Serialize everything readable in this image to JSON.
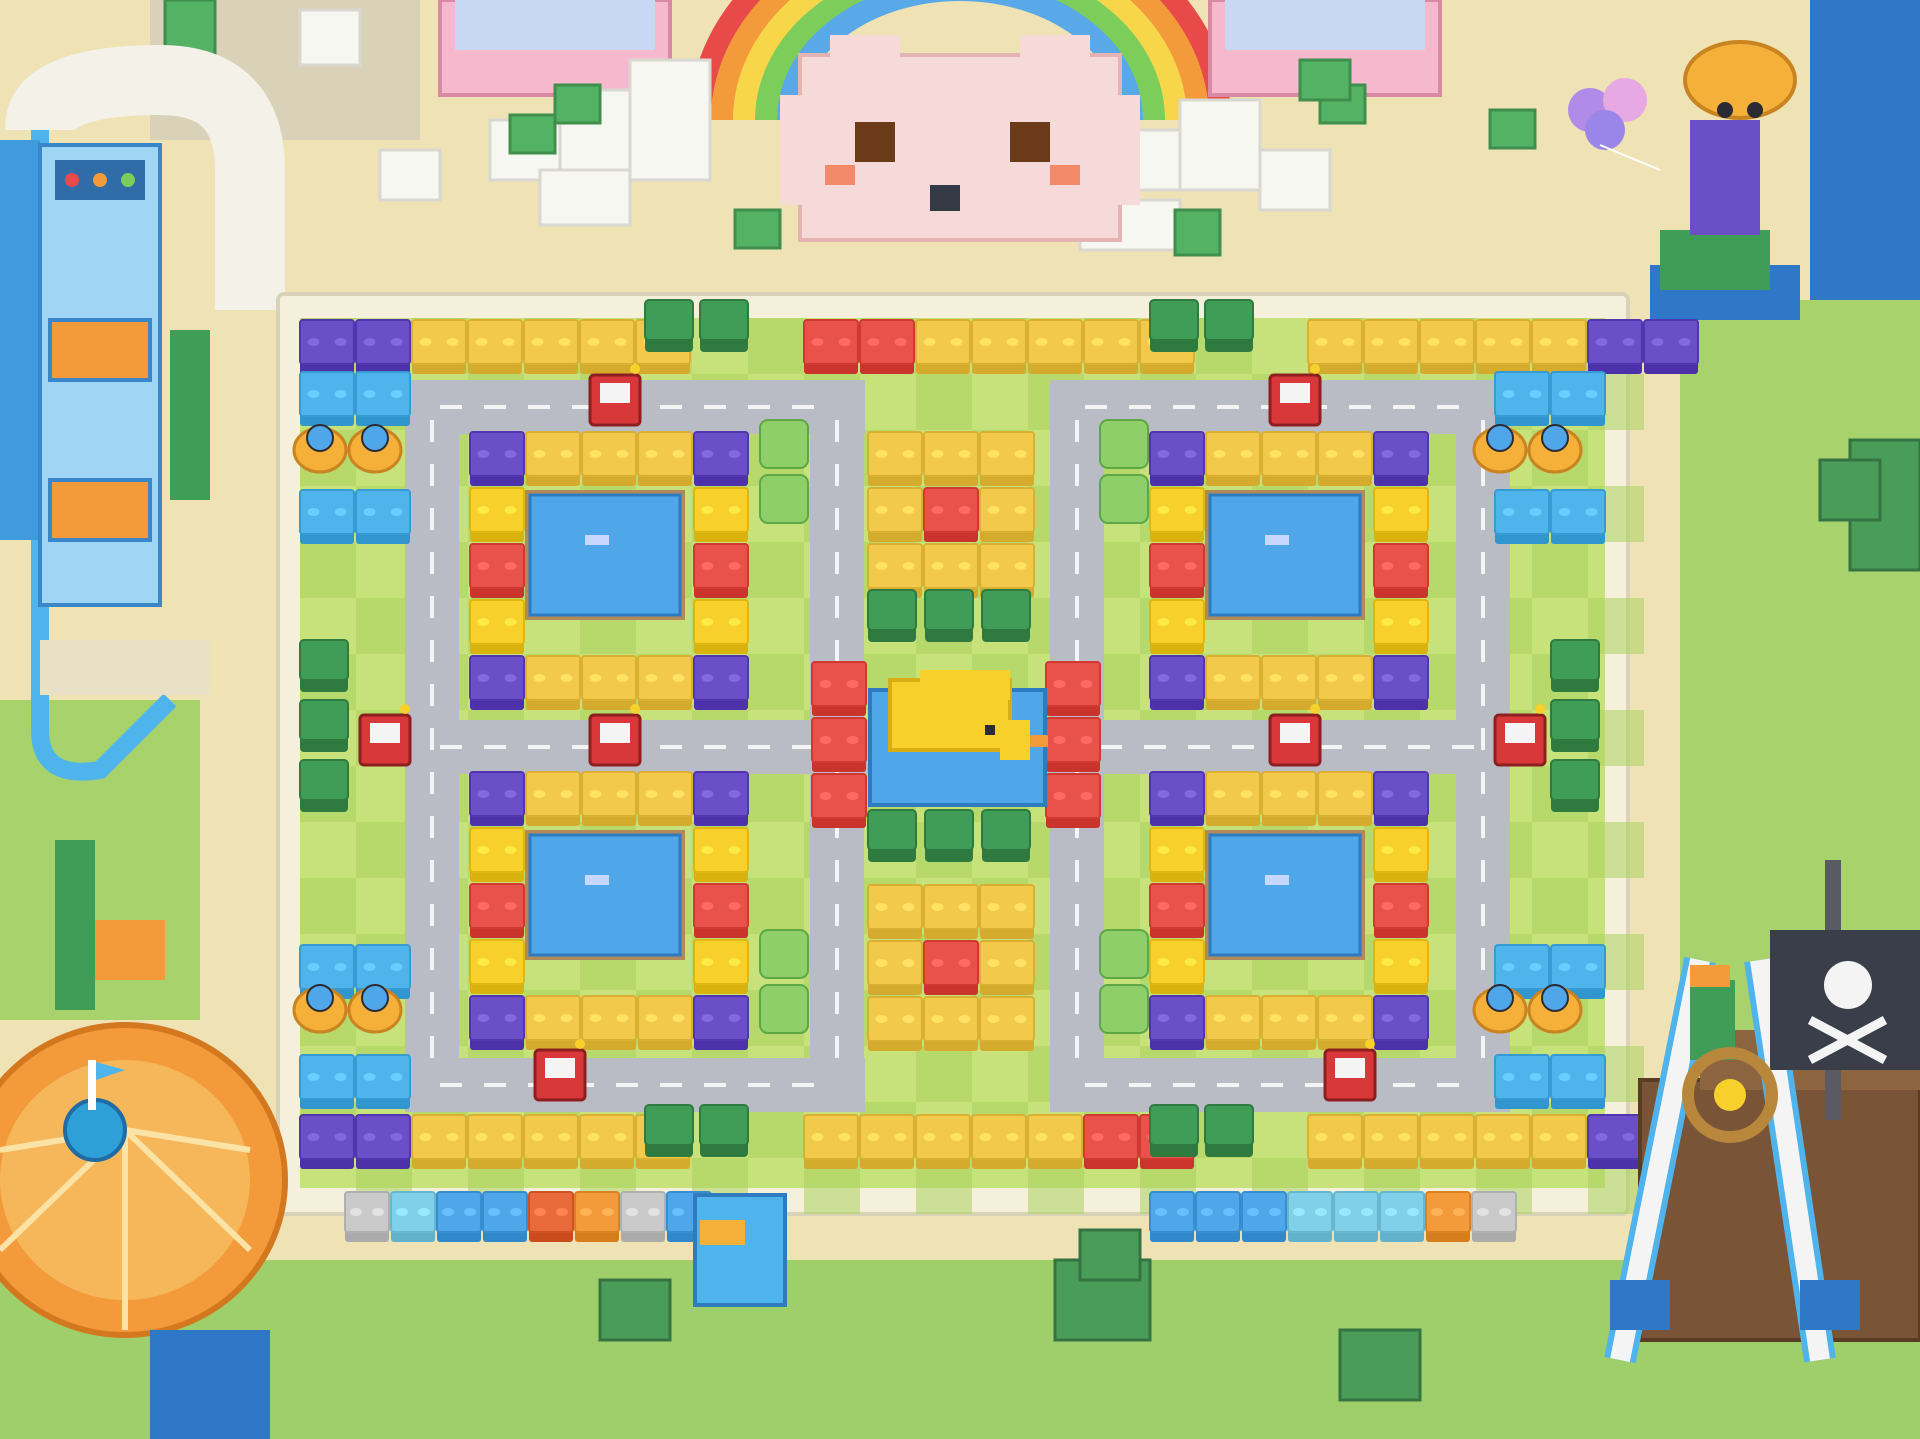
{
  "scene": {
    "description_free": true,
    "game_board": {
      "quadrants": [
        {
          "name": "top-left-block"
        },
        {
          "name": "top-right-block"
        },
        {
          "name": "bottom-left-block"
        },
        {
          "name": "bottom-right-block"
        }
      ],
      "cars": 10,
      "fountain_pools": 4,
      "center_piece": "yellow-duck-fountain"
    },
    "colors": {
      "sand": "#efe2b4",
      "board_rim": "#f4f0dc",
      "road": "#b9bcc4",
      "grass_light": "#c7e27a",
      "grass_dark": "#a9d15e",
      "brick_yellow": "#f2c94a",
      "brick_red": "#e8524a",
      "brick_purple": "#6b4fc8",
      "brick_blue": "#4fb4ec",
      "brick_green": "#3f9d57",
      "water": "#4fa6e8",
      "duck": "#f7d02c",
      "car_red": "#d8383a"
    },
    "decorations": [
      {
        "name": "roller-coaster-icon"
      },
      {
        "name": "rainbow-icon"
      },
      {
        "name": "bunny-face-icon"
      },
      {
        "name": "balloon-robot-icon"
      },
      {
        "name": "carousel-icon"
      },
      {
        "name": "pirate-ship-swing-icon"
      },
      {
        "name": "skull-flag-icon"
      },
      {
        "name": "parrot-icon"
      },
      {
        "name": "ships-wheel-icon"
      }
    ]
  }
}
